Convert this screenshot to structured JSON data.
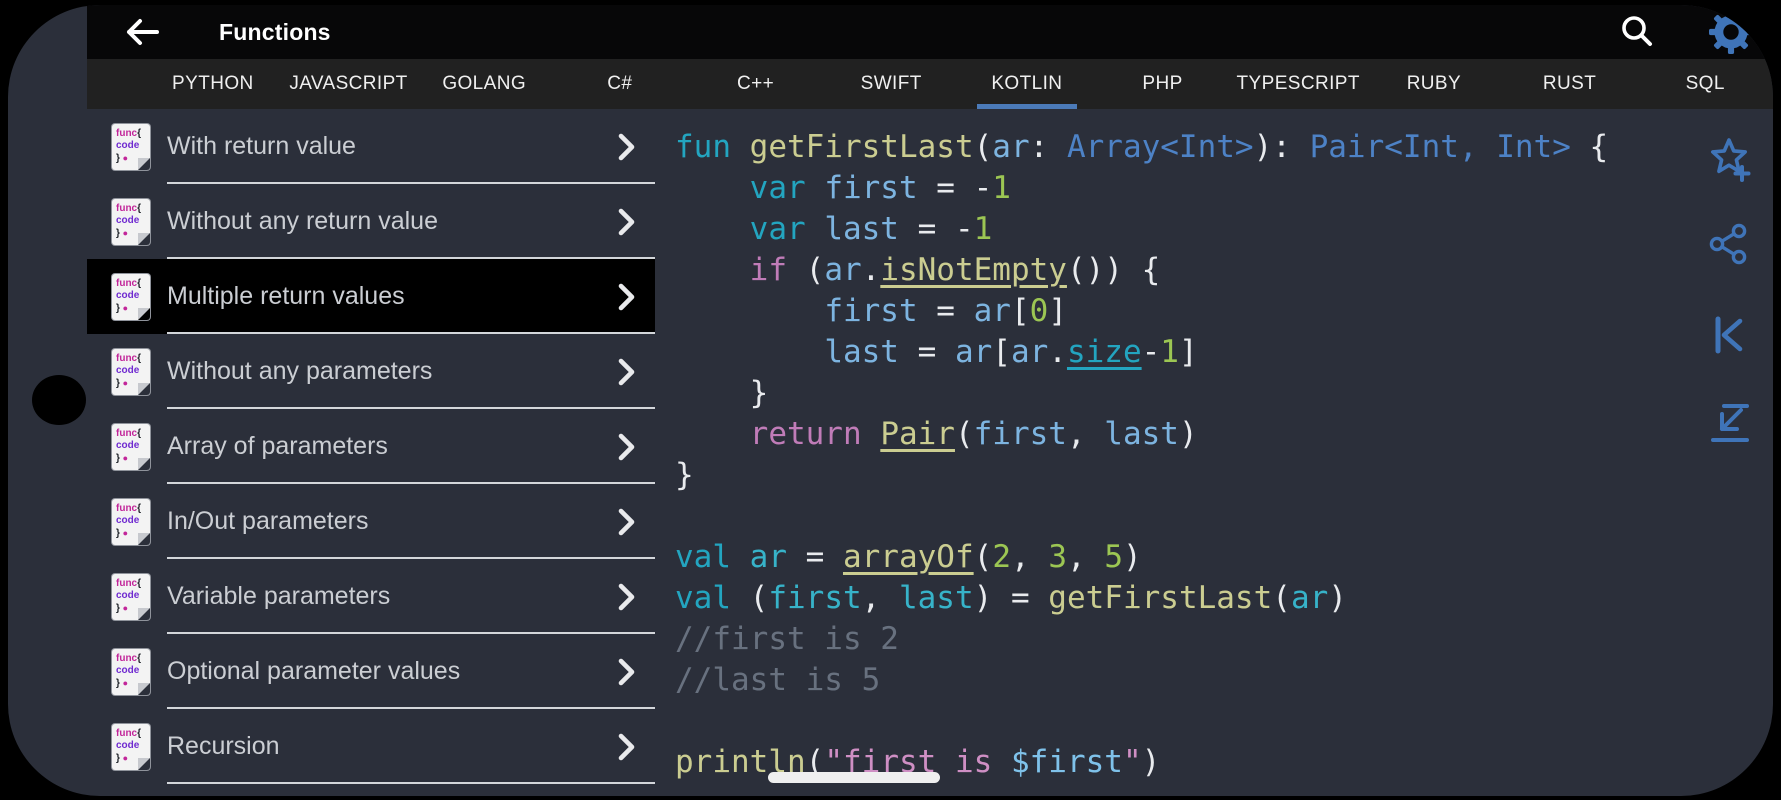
{
  "app": {
    "title": "Functions"
  },
  "topbar": {
    "icons": [
      "back-arrow-icon",
      "search-icon",
      "settings-gear-icon"
    ],
    "accent_blue": "#3f74b8"
  },
  "tabs": {
    "items": [
      "PYTHON",
      "JAVASCRIPT",
      "GOLANG",
      "C#",
      "C++",
      "SWIFT",
      "KOTLIN",
      "PHP",
      "TYPESCRIPT",
      "RUBY",
      "RUST",
      "SQL"
    ],
    "active_index": 6,
    "indicator_color": "#4b7ab8"
  },
  "sidebar": {
    "selected_index": 2,
    "items": [
      {
        "label": "With return value"
      },
      {
        "label": "Without any return value"
      },
      {
        "label": "Multiple return values"
      },
      {
        "label": "Without any parameters"
      },
      {
        "label": "Array of parameters"
      },
      {
        "label": "In/Out parameters"
      },
      {
        "label": "Variable parameters"
      },
      {
        "label": "Optional parameter values"
      },
      {
        "label": "Recursion"
      }
    ],
    "doc_icon": {
      "name": "function-doc-icon",
      "lines": [
        [
          [
            "mag",
            "func"
          ],
          [
            "blk",
            "{"
          ]
        ],
        [
          [
            "pur",
            "code"
          ]
        ],
        [
          [
            "blk",
            "} "
          ],
          [
            "mag dot",
            "●"
          ]
        ]
      ]
    }
  },
  "code": {
    "language": "KOTLIN",
    "token_colors": {
      "kw": "#23a5c0",
      "kwu": "#23a5c0",
      "fn": "#cbcd91",
      "fnu": "#cbcd91",
      "ty": "#4d82c6",
      "va": "#7db4e0",
      "tv": "#37b3c9",
      "num": "#9cc653",
      "pk": "#c07cb8",
      "com": "#68717f",
      "str": "#cf8fc4",
      "sv": "#7fc2ea",
      "pun": "#e9ebee"
    },
    "underlined": [
      "kwu",
      "fnu"
    ],
    "lines": [
      [
        [
          "kw",
          "fun "
        ],
        [
          "fn",
          "getFirstLast"
        ],
        [
          "pun",
          "("
        ],
        [
          "va",
          "ar"
        ],
        [
          "pun",
          ": "
        ],
        [
          "ty",
          "Array<Int>"
        ],
        [
          "pun",
          "): "
        ],
        [
          "ty",
          "Pair<Int, Int>"
        ],
        [
          "pun",
          " {"
        ]
      ],
      [
        [
          "pun",
          "    "
        ],
        [
          "kw",
          "var "
        ],
        [
          "va",
          "first"
        ],
        [
          "pun",
          " = -"
        ],
        [
          "num",
          "1"
        ]
      ],
      [
        [
          "pun",
          "    "
        ],
        [
          "kw",
          "var "
        ],
        [
          "va",
          "last"
        ],
        [
          "pun",
          " = -"
        ],
        [
          "num",
          "1"
        ]
      ],
      [
        [
          "pun",
          "    "
        ],
        [
          "pk",
          "if"
        ],
        [
          "pun",
          " ("
        ],
        [
          "va",
          "ar"
        ],
        [
          "pun",
          "."
        ],
        [
          "fnu",
          "isNotEmpty"
        ],
        [
          "pun",
          "()) {"
        ]
      ],
      [
        [
          "pun",
          "        "
        ],
        [
          "va",
          "first"
        ],
        [
          "pun",
          " = "
        ],
        [
          "va",
          "ar"
        ],
        [
          "pun",
          "["
        ],
        [
          "num",
          "0"
        ],
        [
          "pun",
          "]"
        ]
      ],
      [
        [
          "pun",
          "        "
        ],
        [
          "va",
          "last"
        ],
        [
          "pun",
          " = "
        ],
        [
          "va",
          "ar"
        ],
        [
          "pun",
          "["
        ],
        [
          "va",
          "ar"
        ],
        [
          "pun",
          "."
        ],
        [
          "kwu",
          "size"
        ],
        [
          "pun",
          "-"
        ],
        [
          "num",
          "1"
        ],
        [
          "pun",
          "]"
        ]
      ],
      [
        [
          "pun",
          "    }"
        ]
      ],
      [
        [
          "pun",
          "    "
        ],
        [
          "pk",
          "return "
        ],
        [
          "fnu",
          "Pair"
        ],
        [
          "pun",
          "("
        ],
        [
          "va",
          "first"
        ],
        [
          "pun",
          ", "
        ],
        [
          "va",
          "last"
        ],
        [
          "pun",
          ")"
        ]
      ],
      [
        [
          "pun",
          "}"
        ]
      ],
      [],
      [
        [
          "kw",
          "val "
        ],
        [
          "tv",
          "ar"
        ],
        [
          "pun",
          " = "
        ],
        [
          "fnu",
          "arrayOf"
        ],
        [
          "pun",
          "("
        ],
        [
          "num",
          "2"
        ],
        [
          "pun",
          ", "
        ],
        [
          "num",
          "3"
        ],
        [
          "pun",
          ", "
        ],
        [
          "num",
          "5"
        ],
        [
          "pun",
          ")"
        ]
      ],
      [
        [
          "kw",
          "val "
        ],
        [
          "pun",
          "("
        ],
        [
          "tv",
          "first"
        ],
        [
          "pun",
          ", "
        ],
        [
          "tv",
          "last"
        ],
        [
          "pun",
          ") = "
        ],
        [
          "fn",
          "getFirstLast"
        ],
        [
          "pun",
          "("
        ],
        [
          "tv",
          "ar"
        ],
        [
          "pun",
          ")"
        ]
      ],
      [
        [
          "com",
          "//first is 2"
        ]
      ],
      [
        [
          "com",
          "//last is 5"
        ]
      ],
      [],
      [
        [
          "fn",
          "println"
        ],
        [
          "pun",
          "("
        ],
        [
          "str",
          "\"first is "
        ],
        [
          "sv",
          "$first"
        ],
        [
          "str",
          "\""
        ],
        [
          "pun",
          ")"
        ]
      ]
    ]
  },
  "action_rail": {
    "icons": [
      "add-favorite-star-icon",
      "share-icon",
      "skip-to-start-icon",
      "scroll-to-end-icon"
    ],
    "icon_color": "#3f74b8"
  },
  "device": {
    "body_color": "#2b2f3a",
    "camera": "camera-cutout",
    "home_indicator": true
  }
}
